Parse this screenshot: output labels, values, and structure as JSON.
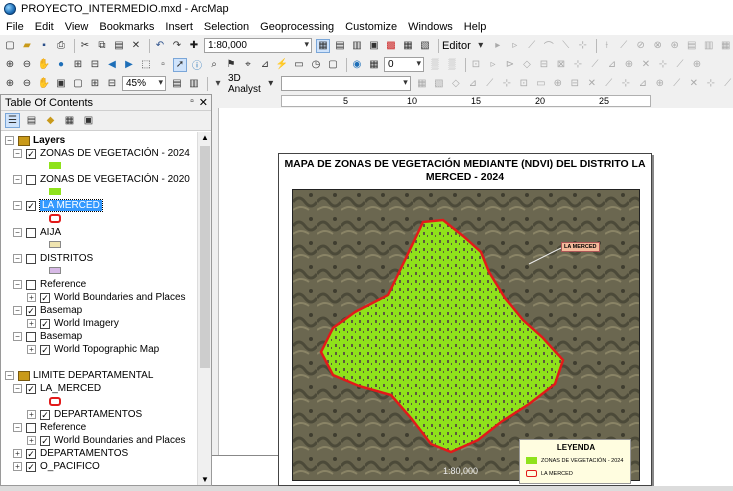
{
  "window": {
    "title": "PROYECTO_INTERMEDIO.mxd - ArcMap"
  },
  "menu": [
    "File",
    "Edit",
    "View",
    "Bookmarks",
    "Insert",
    "Selection",
    "Geoprocessing",
    "Customize",
    "Windows",
    "Help"
  ],
  "toolbar": {
    "scale_value": "1:80,000",
    "editor_label": "Editor",
    "zoom_value": "45%",
    "analyst_label": "3D Analyst",
    "layer_value": "0"
  },
  "toc": {
    "title": "Table Of Contents",
    "rows": [
      {
        "label": "Layers",
        "bold": true
      },
      {
        "label": "ZONAS DE VEGETACIÓN - 2024",
        "checked": true
      },
      {
        "label": "ZONAS DE VEGETACIÓN - 2020",
        "checked": false
      },
      {
        "label": "LA MERCED",
        "checked": true,
        "selected": true
      },
      {
        "label": "AIJA",
        "checked": false
      },
      {
        "label": "DISTRITOS",
        "checked": false
      },
      {
        "label": "Reference",
        "checked": false
      },
      {
        "label": "World Boundaries and Places",
        "checked": true
      },
      {
        "label": "Basemap",
        "checked": true
      },
      {
        "label": "World Imagery",
        "checked": true
      },
      {
        "label": "Basemap",
        "checked": false
      },
      {
        "label": "World Topographic Map",
        "checked": true
      },
      {
        "label": "LIMITE DEPARTAMENTAL",
        "bold": false
      },
      {
        "label": "LA_MERCED",
        "checked": true
      },
      {
        "label": "DEPARTAMENTOS",
        "checked": true
      },
      {
        "label": "Reference",
        "checked": false
      },
      {
        "label": "World Boundaries and Places",
        "checked": true
      },
      {
        "label": "DEPARTAMENTOS",
        "checked": true
      },
      {
        "label": "O_PACIFICO",
        "checked": true
      }
    ]
  },
  "ruler": {
    "ticks": [
      "5",
      "10",
      "15",
      "20",
      "25"
    ]
  },
  "map": {
    "title": "MAPA DE ZONAS DE VEGETACIÓN MEDIANTE (NDVI) DEL DISTRITO LA MERCED - 2024",
    "callout": "LA MERCED",
    "scale_text": "1:80,000",
    "legend": {
      "title": "LEYENDA",
      "items": [
        "ZONAS DE VEGETACIÓN - 2024",
        "LA MERCED"
      ]
    }
  },
  "colors": {
    "vegetation": "#8fe21b",
    "boundary": "#e21a1a",
    "aija": "#efe4b0",
    "distritos": "#d7b9e6",
    "selection": "#3399ff"
  }
}
